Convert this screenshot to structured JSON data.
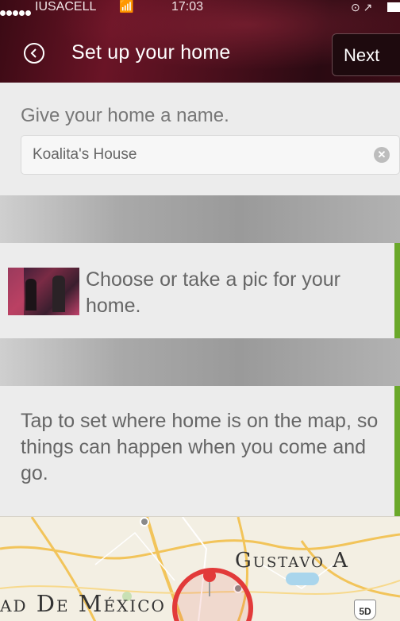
{
  "status_bar": {
    "carrier": "IUSACELL",
    "time": "17:03",
    "wifi_icon": "wifi-icon",
    "battery_icon": "battery-icon"
  },
  "header": {
    "title": "Set up your home",
    "next_label": "Next",
    "back_icon": "back-arrow-circle-icon"
  },
  "name_section": {
    "prompt": "Give your home a name.",
    "name_value": "Koalita's House",
    "clear_icon": "clear-icon"
  },
  "photo_section": {
    "text": "Choose or take a pic for your home.",
    "accent": "#6aa82a"
  },
  "map_section": {
    "text": "Tap to set where home is on the map, so things can happen when you come and go.",
    "label_north": "Gustavo A",
    "label_city": "ad De México",
    "highway_shield": "5D",
    "pin_color": "#e23a3a"
  }
}
